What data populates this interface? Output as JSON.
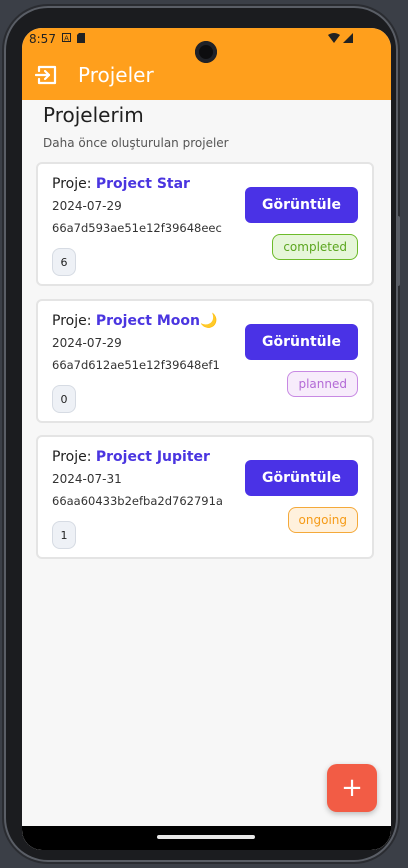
{
  "status_bar": {
    "time": "8:57"
  },
  "app_bar": {
    "title": "Projeler"
  },
  "page": {
    "heading": "Projelerim",
    "subheading": "Daha önce oluşturulan projeler"
  },
  "projects": [
    {
      "label": "Proje: ",
      "name": "Project Star",
      "date": "2024-07-29",
      "id": "66a7d593ae51e12f39648eec",
      "count": "6",
      "button": "Görüntüle",
      "status": "completed"
    },
    {
      "label": "Proje: ",
      "name": "Project Moon🌙",
      "date": "2024-07-29",
      "id": "66a7d612ae51e12f39648ef1",
      "count": "0",
      "button": "Görüntüle",
      "status": "planned"
    },
    {
      "label": "Proje: ",
      "name": "Project Jupiter",
      "date": "2024-07-31",
      "id": "66aa60433b2efba2d762791a",
      "count": "1",
      "button": "Görüntüle",
      "status": "ongoing"
    }
  ],
  "fab": {
    "label": "+"
  },
  "colors": {
    "accent": "#ff9f1c",
    "primary": "#4a32e6",
    "fab": "#f25c45",
    "completed": {
      "text": "#5ba61f",
      "bg": "#e6f6d9",
      "border": "#6dbb2a"
    },
    "planned": {
      "text": "#b36ad6",
      "bg": "#f7ecfb",
      "border": "#c889e3"
    },
    "ongoing": {
      "text": "#f59b18",
      "bg": "#fff1dd",
      "border": "#f4a93a"
    }
  }
}
